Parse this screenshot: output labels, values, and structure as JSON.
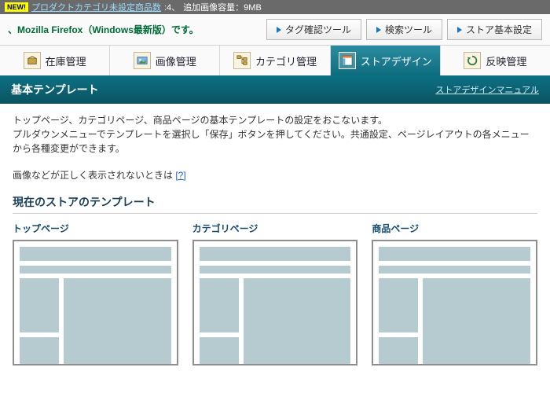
{
  "topbar": {
    "newBadge": "NEW!",
    "linkText": "プロダクトカテゴリ未設定商品数",
    "linkCount": ":4、",
    "extra": "追加画像容量：9MB"
  },
  "browserNote": "、Mozilla Firefox（Windows最新版）です。",
  "toolButtons": {
    "tag": "タグ確認ツール",
    "search": "検索ツール",
    "store": "ストア基本設定"
  },
  "tabs": [
    {
      "label": "在庫管理",
      "icon": "box-icon"
    },
    {
      "label": "画像管理",
      "icon": "image-icon"
    },
    {
      "label": "カテゴリ管理",
      "icon": "tree-icon"
    },
    {
      "label": "ストアデザイン",
      "icon": "layout-icon"
    },
    {
      "label": "反映管理",
      "icon": "refresh-icon"
    }
  ],
  "subheader": {
    "title": "基本テンプレート",
    "manualLink": "ストアデザインマニュアル"
  },
  "description": "トップページ、カテゴリページ、商品ページの基本テンプレートの設定をおこないます。\nプルダウンメニューでテンプレートを選択し「保存」ボタンを押してください。共通設定、ページレイアウトの各メニューから各種変更ができます。",
  "helpLine": {
    "prefix": "画像などが正しく表示されないときは ",
    "link": "[?]"
  },
  "currentTemplateTitle": "現在のストアのテンプレート",
  "previews": [
    {
      "label": "トップページ"
    },
    {
      "label": "カテゴリページ"
    },
    {
      "label": "商品ページ"
    }
  ],
  "activeTabIndex": 3
}
